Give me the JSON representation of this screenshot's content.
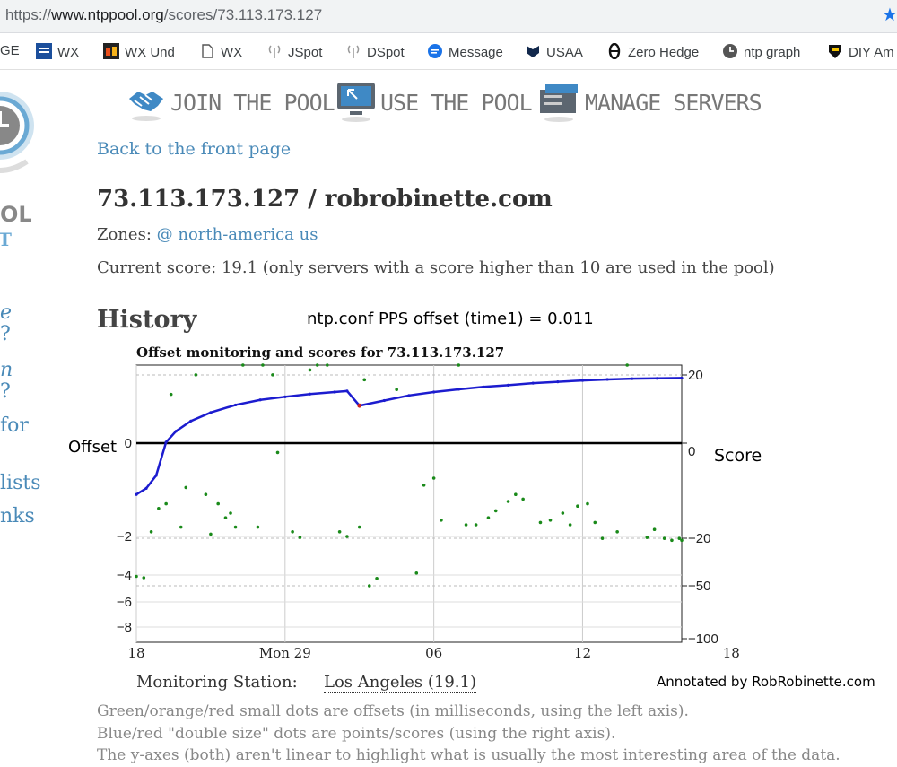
{
  "browser": {
    "url_prefix": "https://",
    "url_host": "www.ntppool.org",
    "url_path": "/scores/73.113.173.127",
    "bookmarks": [
      {
        "label": "GE",
        "icon": "none"
      },
      {
        "label": "WX",
        "icon": "weather-channel-icon"
      },
      {
        "label": "WX Und",
        "icon": "wunderground-icon"
      },
      {
        "label": "WX",
        "icon": "page-icon"
      },
      {
        "label": "JSpot",
        "icon": "antenna-icon"
      },
      {
        "label": "DSpot",
        "icon": "antenna-icon"
      },
      {
        "label": "Message",
        "icon": "chat-icon"
      },
      {
        "label": "USAA",
        "icon": "usaa-icon"
      },
      {
        "label": "Zero Hedge",
        "icon": "zerohedge-icon"
      },
      {
        "label": "ntp graph",
        "icon": "clock-icon"
      },
      {
        "label": "DIY Am",
        "icon": "tdp-icon"
      }
    ]
  },
  "nav": {
    "join": "JOIN THE POOL",
    "use": "USE THE POOL",
    "manage": "MANAGE SERVERS"
  },
  "sidebar": {
    "logo_text": "OL",
    "items": [
      "e",
      "?",
      "n",
      "?",
      " for",
      "lists",
      "nks"
    ]
  },
  "page": {
    "back_link": "Back to the front page",
    "title": "73.113.173.127 / robrobinette.com",
    "zones_label": "Zones:",
    "zones_links": "@ north-america us",
    "current_score": "Current score: 19.1 (only servers with a score higher than 10 are used in the pool)",
    "history_heading": "History",
    "annotation_top": "ntp.conf PPS offset (time1) = 0.011",
    "chart_title": "Offset monitoring and scores for 73.113.173.127",
    "label_offset": "Offset",
    "label_score": "Score",
    "station_label": "Monitoring Station:",
    "station_value": "Los Angeles (19.1)",
    "annotation_bottom": "Annotated by RobRobinette.com",
    "notes": [
      "Green/orange/red small dots are offsets (in milliseconds, using the left axis).",
      "Blue/red \"double size\" dots are points/scores (using the right axis).",
      "The y-axes (both) aren't linear to highlight what is usually the most interesting area of the data."
    ]
  },
  "colors": {
    "link": "#4a8ab8",
    "score_line": "#1c1ccf",
    "offset_dot": "#1a8a1a",
    "score_drop_dot": "#cc2222"
  },
  "chart_data": {
    "type": "scatter",
    "title": "Offset monitoring and scores for 73.113.173.127",
    "x_tick_labels": [
      "18",
      "Mon 29",
      "06",
      "12",
      "18"
    ],
    "x_range_days": [
      0,
      22
    ],
    "x_tick_days": [
      0,
      6,
      12,
      18,
      24
    ],
    "left_axis": {
      "label": "Offset",
      "ticks": [
        0,
        -2,
        -4,
        -6,
        -8
      ],
      "ylim": [
        -8.6,
        1.6
      ]
    },
    "right_axis": {
      "label": "Score",
      "ticks": [
        20,
        0,
        -20,
        -50,
        -100
      ],
      "ylim": [
        -100,
        20
      ]
    },
    "score_series": {
      "name": "score",
      "points": [
        [
          0,
          -10.8
        ],
        [
          0.4,
          -9.5
        ],
        [
          0.8,
          -6.8
        ],
        [
          1.2,
          0.3
        ],
        [
          1.6,
          3.5
        ],
        [
          2.2,
          6.5
        ],
        [
          3,
          9
        ],
        [
          4,
          11.2
        ],
        [
          5,
          12.7
        ],
        [
          6,
          13.6
        ],
        [
          7,
          14.4
        ],
        [
          8,
          15
        ],
        [
          8.5,
          15.3
        ],
        [
          9,
          11
        ],
        [
          10,
          12.5
        ],
        [
          11,
          14
        ],
        [
          12,
          15
        ],
        [
          13,
          15.8
        ],
        [
          14,
          16.5
        ],
        [
          15,
          17
        ],
        [
          16,
          17.6
        ],
        [
          17,
          18
        ],
        [
          18,
          18.4
        ],
        [
          19,
          18.7
        ],
        [
          20,
          18.9
        ],
        [
          21,
          19
        ],
        [
          22,
          19.1
        ]
      ],
      "drop_point": [
        9,
        11
      ]
    },
    "offset_series": {
      "name": "offset",
      "points": [
        [
          0,
          -4.1
        ],
        [
          0.3,
          -4.2
        ],
        [
          0.6,
          -1.9
        ],
        [
          0.9,
          -1.4
        ],
        [
          1.2,
          -1.3
        ],
        [
          1.4,
          1.0
        ],
        [
          1.8,
          -1.8
        ],
        [
          2.0,
          -0.95
        ],
        [
          2.4,
          1.4
        ],
        [
          2.8,
          -1.1
        ],
        [
          3.0,
          -1.95
        ],
        [
          3.3,
          -1.3
        ],
        [
          3.6,
          -1.6
        ],
        [
          3.8,
          -1.5
        ],
        [
          4.0,
          -1.8
        ],
        [
          4.3,
          2.1
        ],
        [
          4.9,
          -1.8
        ],
        [
          5.1,
          1.6
        ],
        [
          5.5,
          1.4
        ],
        [
          5.7,
          -0.2
        ],
        [
          6.3,
          -1.9
        ],
        [
          6.6,
          -2.05
        ],
        [
          7.0,
          1.5
        ],
        [
          7.3,
          1.7
        ],
        [
          7.7,
          2.6
        ],
        [
          8.2,
          -1.9
        ],
        [
          8.5,
          -2.0
        ],
        [
          9.0,
          -1.8
        ],
        [
          9.2,
          1.3
        ],
        [
          9.4,
          -4.8
        ],
        [
          9.7,
          -4.25
        ],
        [
          10.5,
          1.1
        ],
        [
          11.3,
          -3.9
        ],
        [
          11.6,
          -0.9
        ],
        [
          12.0,
          -0.75
        ],
        [
          12.3,
          -1.65
        ],
        [
          13.0,
          1.8
        ],
        [
          13.3,
          -1.75
        ],
        [
          13.7,
          -1.75
        ],
        [
          14.2,
          -1.6
        ],
        [
          14.5,
          -1.45
        ],
        [
          15.0,
          -1.25
        ],
        [
          15.3,
          -1.1
        ],
        [
          15.6,
          -1.2
        ],
        [
          16.3,
          -1.7
        ],
        [
          16.7,
          -1.65
        ],
        [
          17.2,
          -1.5
        ],
        [
          17.5,
          -1.75
        ],
        [
          17.8,
          -1.35
        ],
        [
          18.2,
          -1.3
        ],
        [
          18.5,
          -1.7
        ],
        [
          18.8,
          -2.1
        ],
        [
          19.4,
          -1.9
        ],
        [
          19.8,
          1.6
        ],
        [
          20.6,
          -2.05
        ],
        [
          20.9,
          -1.85
        ],
        [
          21.3,
          -2.1
        ],
        [
          21.6,
          -2.2
        ],
        [
          21.9,
          -2.1
        ],
        [
          22,
          -2.2
        ]
      ]
    }
  }
}
